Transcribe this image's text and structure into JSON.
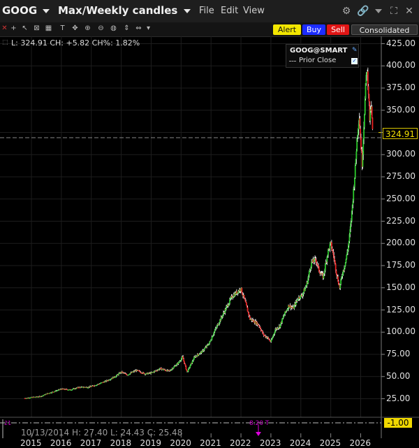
{
  "title": {
    "symbol": "GOOG",
    "mode": "Max/Weekly candles"
  },
  "menu": [
    "File",
    "Edit",
    "View"
  ],
  "buttons": {
    "alert": "Alert",
    "buy": "Buy",
    "sell": "Sell",
    "consolidated": "Consolidated"
  },
  "readout": "L: 324.91 CH: +5.82 CH%: 1.82%",
  "legend": {
    "symbol": "GOOG@SMART",
    "prior_close": "Prior Close"
  },
  "price_tag": "324.91",
  "indicator": {
    "value": "-1.00",
    "marker": "8.20 T",
    "left_marker": "21"
  },
  "ohlc": "10/13/2014  H: 27.40  L: 24.43  C: 25.48",
  "icons": [
    "gear-icon",
    "link-icon",
    "expand-icon",
    "close-icon"
  ],
  "colors": {
    "up": "#2ccb2c",
    "down": "#e82020",
    "price_line": "#f2e000",
    "wick": "#ffffff"
  },
  "chart_data": {
    "type": "candlestick",
    "title": "",
    "xlabel": "",
    "ylabel": "",
    "ylim": [
      0,
      430
    ],
    "y_ticks": [
      "425.00",
      "400.00",
      "375.00",
      "350.00",
      "325.00",
      "300.00",
      "275.00",
      "250.00",
      "225.00",
      "200.00",
      "175.00",
      "150.00",
      "125.00",
      "100.00",
      "75.00",
      "50.00",
      "25.00"
    ],
    "x_ticks": [
      "2015",
      "2016",
      "2017",
      "2018",
      "2019",
      "2020",
      "2021",
      "2022",
      "2023",
      "2024",
      "2025",
      "2026"
    ],
    "x_range": [
      2014.78,
      2026.78
    ],
    "last_price": 324.91,
    "prior_close": 319.09,
    "close_series": [
      [
        2014.78,
        25.5
      ],
      [
        2015.0,
        26.5
      ],
      [
        2015.3,
        27.5
      ],
      [
        2015.55,
        31
      ],
      [
        2015.75,
        33
      ],
      [
        2016.0,
        36
      ],
      [
        2016.3,
        35
      ],
      [
        2016.6,
        38
      ],
      [
        2016.9,
        38
      ],
      [
        2017.2,
        41
      ],
      [
        2017.5,
        45
      ],
      [
        2017.8,
        50
      ],
      [
        2018.0,
        55
      ],
      [
        2018.2,
        52
      ],
      [
        2018.5,
        57
      ],
      [
        2018.8,
        53
      ],
      [
        2019.0,
        54
      ],
      [
        2019.3,
        59
      ],
      [
        2019.6,
        56
      ],
      [
        2019.9,
        65
      ],
      [
        2020.05,
        72
      ],
      [
        2020.2,
        55
      ],
      [
        2020.45,
        72
      ],
      [
        2020.7,
        78
      ],
      [
        2020.95,
        88
      ],
      [
        2021.1,
        100
      ],
      [
        2021.4,
        120
      ],
      [
        2021.7,
        140
      ],
      [
        2021.9,
        146
      ],
      [
        2022.0,
        149
      ],
      [
        2022.15,
        133
      ],
      [
        2022.3,
        115
      ],
      [
        2022.45,
        112
      ],
      [
        2022.6,
        108
      ],
      [
        2022.75,
        97
      ],
      [
        2022.88,
        94
      ],
      [
        2023.0,
        89
      ],
      [
        2023.15,
        103
      ],
      [
        2023.3,
        107
      ],
      [
        2023.45,
        120
      ],
      [
        2023.6,
        130
      ],
      [
        2023.75,
        127
      ],
      [
        2023.9,
        138
      ],
      [
        2024.05,
        142
      ],
      [
        2024.2,
        154
      ],
      [
        2024.35,
        178
      ],
      [
        2024.5,
        182
      ],
      [
        2024.6,
        170
      ],
      [
        2024.75,
        162
      ],
      [
        2024.9,
        190
      ],
      [
        2025.0,
        200
      ],
      [
        2025.1,
        185
      ],
      [
        2025.2,
        165
      ],
      [
        2025.3,
        150
      ],
      [
        2025.38,
        165
      ],
      [
        2025.5,
        180
      ],
      [
        2025.6,
        200
      ],
      [
        2025.68,
        225
      ],
      [
        2025.75,
        255
      ],
      [
        2025.82,
        285
      ],
      [
        2025.88,
        320
      ],
      [
        2025.95,
        345
      ],
      [
        2026.0,
        315
      ],
      [
        2026.05,
        290
      ],
      [
        2026.12,
        345
      ],
      [
        2026.2,
        398
      ],
      [
        2026.25,
        380
      ],
      [
        2026.3,
        340
      ],
      [
        2026.35,
        355
      ],
      [
        2026.4,
        324.9
      ]
    ]
  }
}
